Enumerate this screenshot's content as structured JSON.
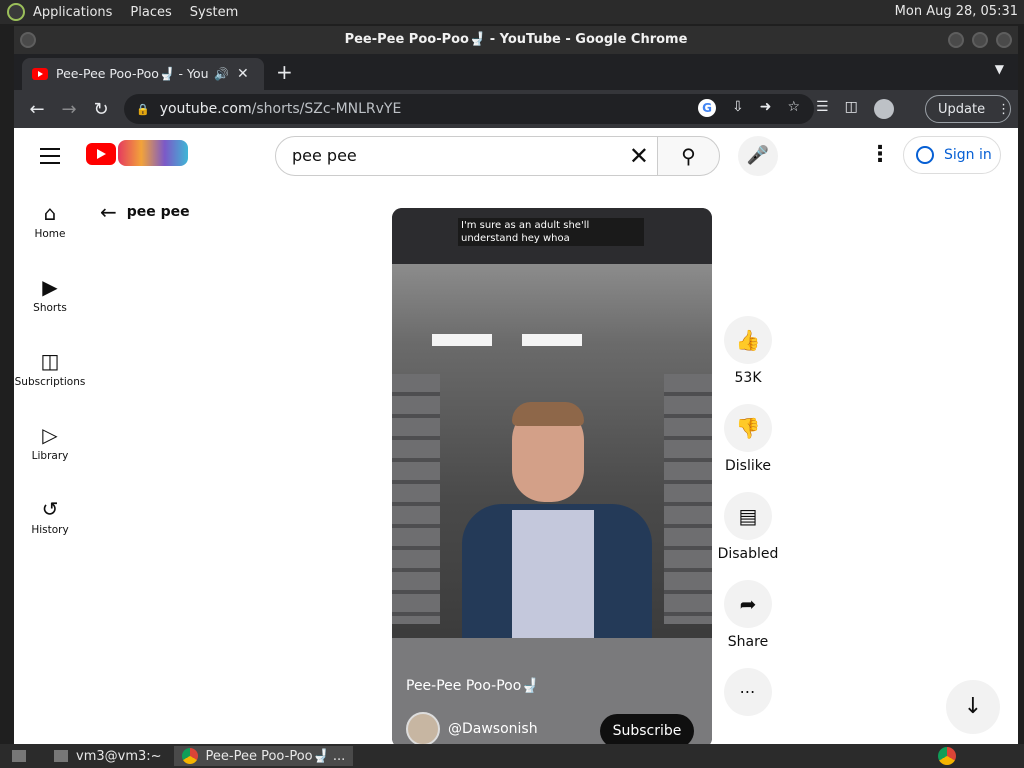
{
  "os_panel": {
    "menus": [
      "Applications",
      "Places",
      "System"
    ],
    "clock": "Mon Aug 28, 05:31"
  },
  "window": {
    "title": "Pee-Pee Poo-Poo🚽 - YouTube - Google Chrome"
  },
  "tab": {
    "title": "Pee-Pee Poo-Poo🚽 - YouTube",
    "audio_icon": "speaker-icon",
    "close": "✕"
  },
  "toolbar": {
    "url_host": "youtube.com",
    "url_path": "/shorts/SZc-MNLRvYE",
    "update_label": "Update"
  },
  "youtube": {
    "search_value": "pee pee",
    "signin_label": "Sign in",
    "guide": [
      {
        "label": "Home",
        "icon": "home-icon"
      },
      {
        "label": "Shorts",
        "icon": "shorts-icon"
      },
      {
        "label": "Subscriptions",
        "icon": "subscriptions-icon"
      },
      {
        "label": "Library",
        "icon": "library-icon"
      },
      {
        "label": "History",
        "icon": "history-icon"
      }
    ],
    "back_query": "pee pee",
    "short": {
      "caption": "I'm sure as an adult she'll understand hey whoa",
      "title": "Pee-Pee Poo-Poo🚽",
      "channel": "@Dawsonish",
      "subscribe_label": "Subscribe"
    },
    "actions": {
      "like_count": "53K",
      "dislike_label": "Dislike",
      "comments_label": "Disabled",
      "share_label": "Share"
    }
  },
  "taskbar": {
    "terminal": "vm3@vm3:~",
    "chrome_task": "Pee-Pee Poo-Poo🚽 ..."
  },
  "colors": {
    "youtube_red": "#ff0000",
    "signin_blue": "#065fd4",
    "chrome_dark": "#202124"
  }
}
